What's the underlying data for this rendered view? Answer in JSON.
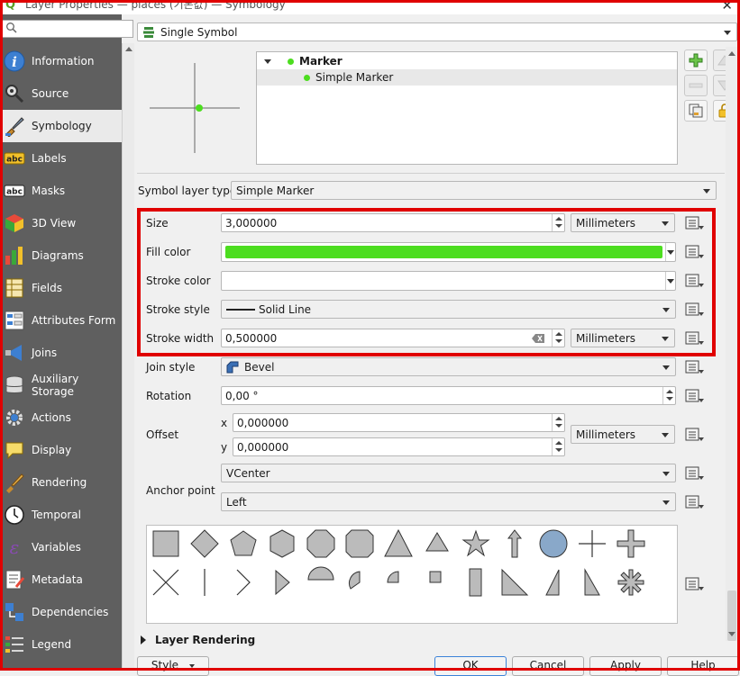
{
  "window": {
    "title": "Layer Properties — places (기본값) — Symbology",
    "close_glyph": "✕"
  },
  "sidebar": {
    "search_placeholder": "",
    "items": [
      {
        "label": "Information",
        "icon": "information-icon"
      },
      {
        "label": "Source",
        "icon": "source-icon"
      },
      {
        "label": "Symbology",
        "icon": "symbology-icon",
        "selected": true
      },
      {
        "label": "Labels",
        "icon": "labels-icon"
      },
      {
        "label": "Masks",
        "icon": "masks-icon"
      },
      {
        "label": "3D View",
        "icon": "3d-view-icon"
      },
      {
        "label": "Diagrams",
        "icon": "diagrams-icon"
      },
      {
        "label": "Fields",
        "icon": "fields-icon"
      },
      {
        "label": "Attributes Form",
        "icon": "attributes-form-icon"
      },
      {
        "label": "Joins",
        "icon": "joins-icon"
      },
      {
        "label": "Auxiliary Storage",
        "icon": "auxiliary-storage-icon"
      },
      {
        "label": "Actions",
        "icon": "actions-icon"
      },
      {
        "label": "Display",
        "icon": "display-icon"
      },
      {
        "label": "Rendering",
        "icon": "rendering-icon"
      },
      {
        "label": "Temporal",
        "icon": "temporal-icon"
      },
      {
        "label": "Variables",
        "icon": "variables-icon"
      },
      {
        "label": "Metadata",
        "icon": "metadata-icon"
      },
      {
        "label": "Dependencies",
        "icon": "dependencies-icon"
      },
      {
        "label": "Legend",
        "icon": "legend-icon"
      }
    ]
  },
  "renderer": {
    "type": "Single Symbol"
  },
  "symbol_tree": {
    "root": "Marker",
    "child": "Simple Marker"
  },
  "symbol_layer_type": {
    "label": "Symbol layer type",
    "value": "Simple Marker"
  },
  "props": {
    "size": {
      "label": "Size",
      "value": "3,000000",
      "unit": "Millimeters"
    },
    "fill_color": {
      "label": "Fill color",
      "color": "#4cdd1f"
    },
    "stroke_color": {
      "label": "Stroke color",
      "color": "#ffffff"
    },
    "stroke_style": {
      "label": "Stroke style",
      "value": "Solid Line"
    },
    "stroke_width": {
      "label": "Stroke width",
      "value": "0,500000",
      "unit": "Millimeters"
    },
    "join_style": {
      "label": "Join style",
      "value": "Bevel"
    },
    "rotation": {
      "label": "Rotation",
      "value": "0,00 °"
    },
    "offset": {
      "label": "Offset",
      "x_label": "x",
      "x": "0,000000",
      "y_label": "y",
      "y": "0,000000",
      "unit": "Millimeters"
    },
    "anchor": {
      "label": "Anchor point",
      "vertical": "VCenter",
      "horizontal": "Left"
    }
  },
  "layer_rendering": {
    "label": "Layer Rendering"
  },
  "buttons": {
    "style": "Style",
    "ok": "OK",
    "cancel": "Cancel",
    "apply": "Apply",
    "help": "Help"
  },
  "colors": {
    "accent_red": "#e00000",
    "sidebar_bg": "#5f5f5f",
    "marker_green": "#4cdd1f"
  }
}
